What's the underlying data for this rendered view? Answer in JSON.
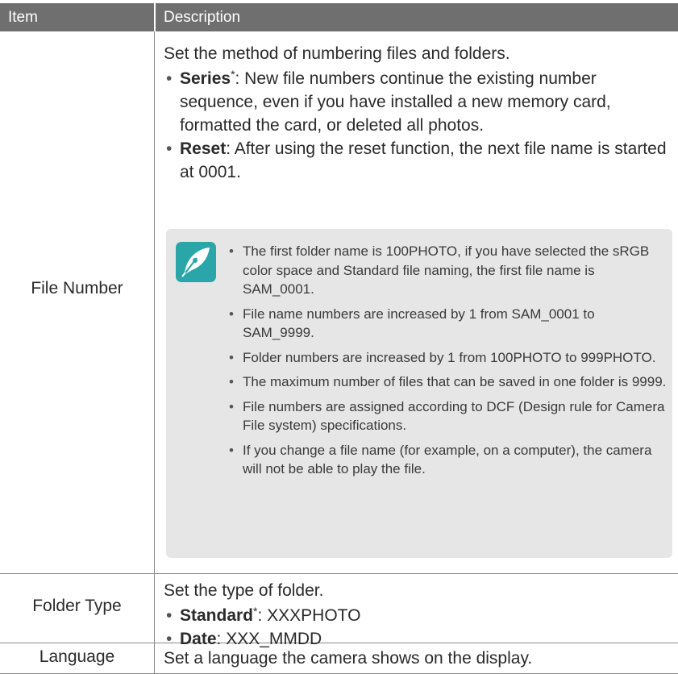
{
  "header": {
    "col_item": "Item",
    "col_description": "Description"
  },
  "rows": {
    "file_number": {
      "label": "File Number",
      "intro": "Set the method of numbering files and folders.",
      "options": [
        {
          "name": "Series",
          "mark": "*",
          "text": ": New file numbers continue the existing number sequence, even if you have installed a new memory card, formatted the card, or deleted all photos."
        },
        {
          "name": "Reset",
          "text": ": After using the reset function, the next file name is started at 0001."
        }
      ],
      "notes": [
        "The first folder name is 100PHOTO, if you have selected the sRGB color space and Standard file naming, the first file name is SAM_0001.",
        "File name numbers are increased by 1 from SAM_0001 to SAM_9999.",
        "Folder numbers are increased by 1 from 100PHOTO to 999PHOTO.",
        "The maximum number of files that can be saved in one folder is 9999.",
        "File numbers are assigned according to DCF (Design rule for Camera File system) specifications.",
        "If you change a file name (for example, on a computer), the camera will not be able to play the file."
      ],
      "note_icon": "pen-nib-icon"
    },
    "folder_type": {
      "label": "Folder Type",
      "intro": "Set the type of folder.",
      "options": [
        {
          "name": "Standard",
          "mark": "*",
          "text": ": XXXPHOTO"
        },
        {
          "name": "Date",
          "text": ": XXX_MMDD"
        }
      ]
    },
    "language": {
      "label": "Language",
      "intro": "Set a language the camera shows on the display."
    }
  },
  "colors": {
    "header_bg": "#6f6f6f",
    "note_bg": "#e6e6e6",
    "icon_teal": "#2aa6a9"
  }
}
